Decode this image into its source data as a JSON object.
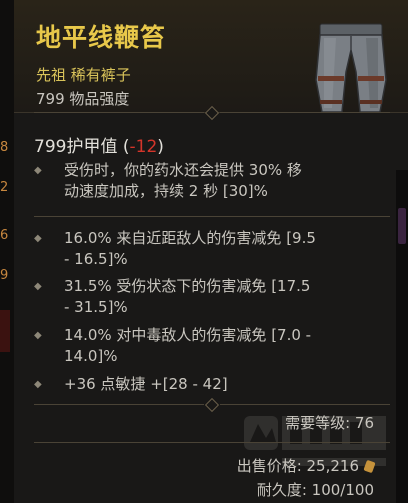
{
  "item": {
    "name": "地平线鞭笞",
    "type": "先祖 稀有裤子",
    "item_power": "799 物品强度",
    "image_icon": "pants-icon"
  },
  "armor": {
    "value": "799护甲值",
    "open_paren": " (",
    "delta": "-12",
    "close_paren": ")"
  },
  "implicit": [
    {
      "line1": "受伤时，你的药水还会提供 30% 移",
      "line2": "动速度加成，持续 2 秒 [30]%"
    }
  ],
  "affixes": [
    {
      "line1": "16.0% 来自近距敌人的伤害减免 [9.5",
      "line2": "- 16.5]%"
    },
    {
      "line1": "31.5% 受伤状态下的伤害减免 [17.5",
      "line2": "- 31.5]%"
    },
    {
      "line1": "14.0% 对中毒敌人的伤害减免 [7.0 -",
      "line2": "14.0]%"
    },
    {
      "line1": "+36 点敏捷 +[28 - 42]",
      "line2": ""
    }
  ],
  "requirement": "需要等级: 76",
  "sell_price": "出售价格: 25,216",
  "durability": "耐久度: 100/100",
  "edge_numbers": [
    "8",
    "2",
    "6",
    "9"
  ],
  "colors": {
    "title_gold": "#e8c84a",
    "rarity_yellow": "#d9c35a",
    "negative_red": "#d4352a",
    "text": "#c9c6bf"
  }
}
